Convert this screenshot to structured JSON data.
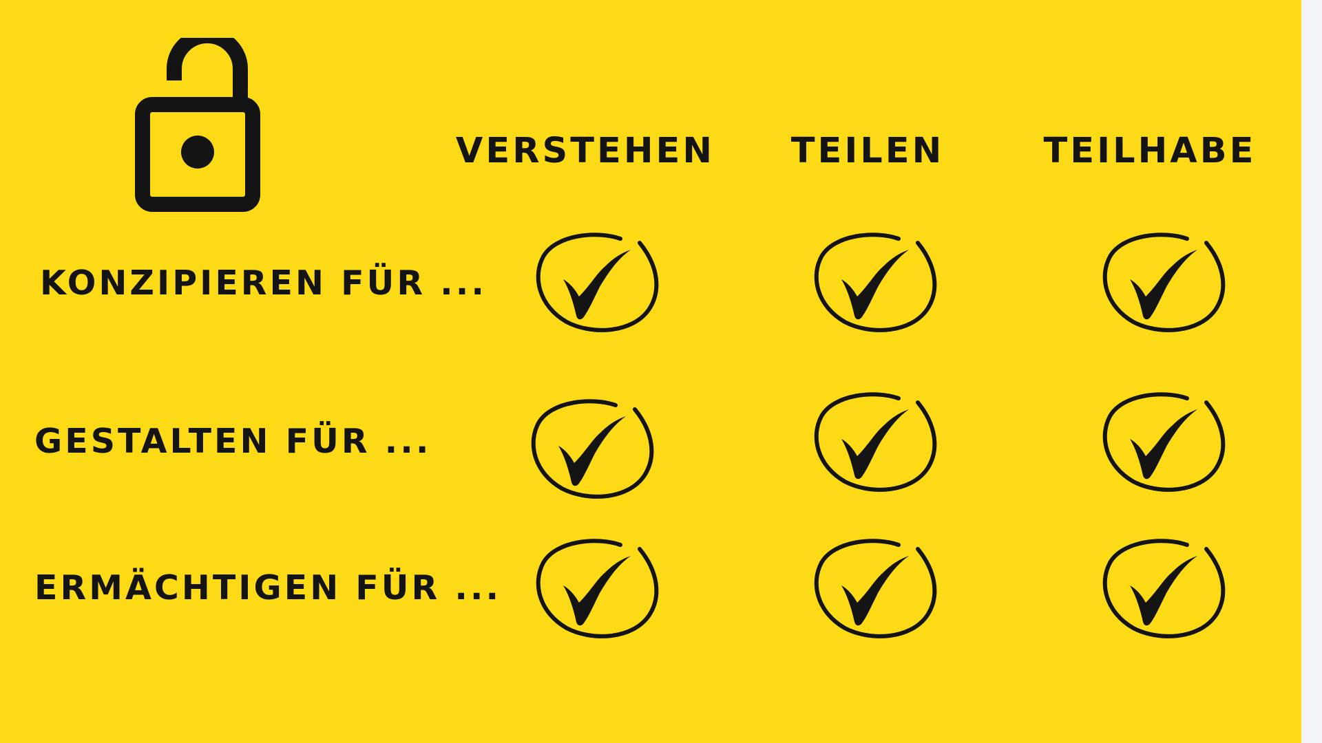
{
  "colors": {
    "background": "#FDDA16",
    "ink": "#141414",
    "side_strip": "#F3F5F9"
  },
  "icons": {
    "header": "unlocked-padlock-icon",
    "cell": "circled-checkmark-icon"
  },
  "columns": [
    {
      "label": "VERSTEHEN"
    },
    {
      "label": "TEILEN"
    },
    {
      "label": "TEILHABE"
    }
  ],
  "rows": [
    {
      "label": "KONZIPIEREN FÜR ...",
      "checks": [
        true,
        true,
        true
      ]
    },
    {
      "label": "GESTALTEN FÜR ...",
      "checks": [
        true,
        true,
        true
      ]
    },
    {
      "label": "ERMÄCHTIGEN FÜR ...",
      "checks": [
        true,
        true,
        true
      ]
    }
  ]
}
